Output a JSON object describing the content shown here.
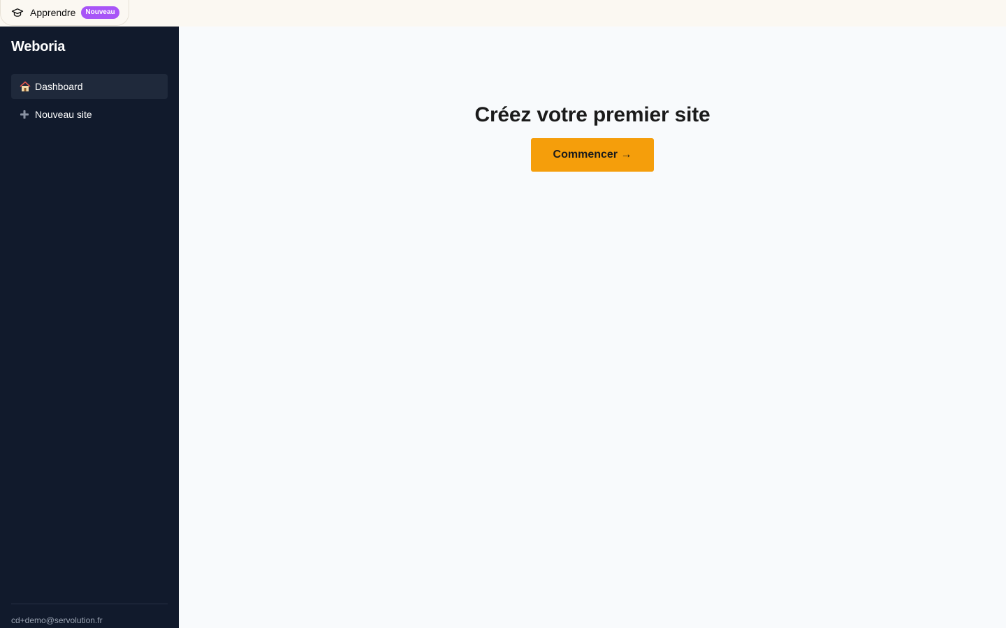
{
  "topbar": {
    "learn_label": "Apprendre",
    "learn_badge": "Nouveau",
    "icon": "graduation-cap-icon",
    "badge_color": "#a855f7"
  },
  "sidebar": {
    "brand": "Weboria",
    "items": [
      {
        "icon": "house-icon",
        "label": "Dashboard",
        "active": true
      },
      {
        "icon": "plus-icon",
        "label": "Nouveau site",
        "active": false
      }
    ],
    "user_email": "cd+demo@servolution.fr",
    "background": "#111a2c"
  },
  "main": {
    "title": "Créez votre premier site",
    "cta_label": "Commencer →",
    "cta_color": "#f59e0b"
  }
}
